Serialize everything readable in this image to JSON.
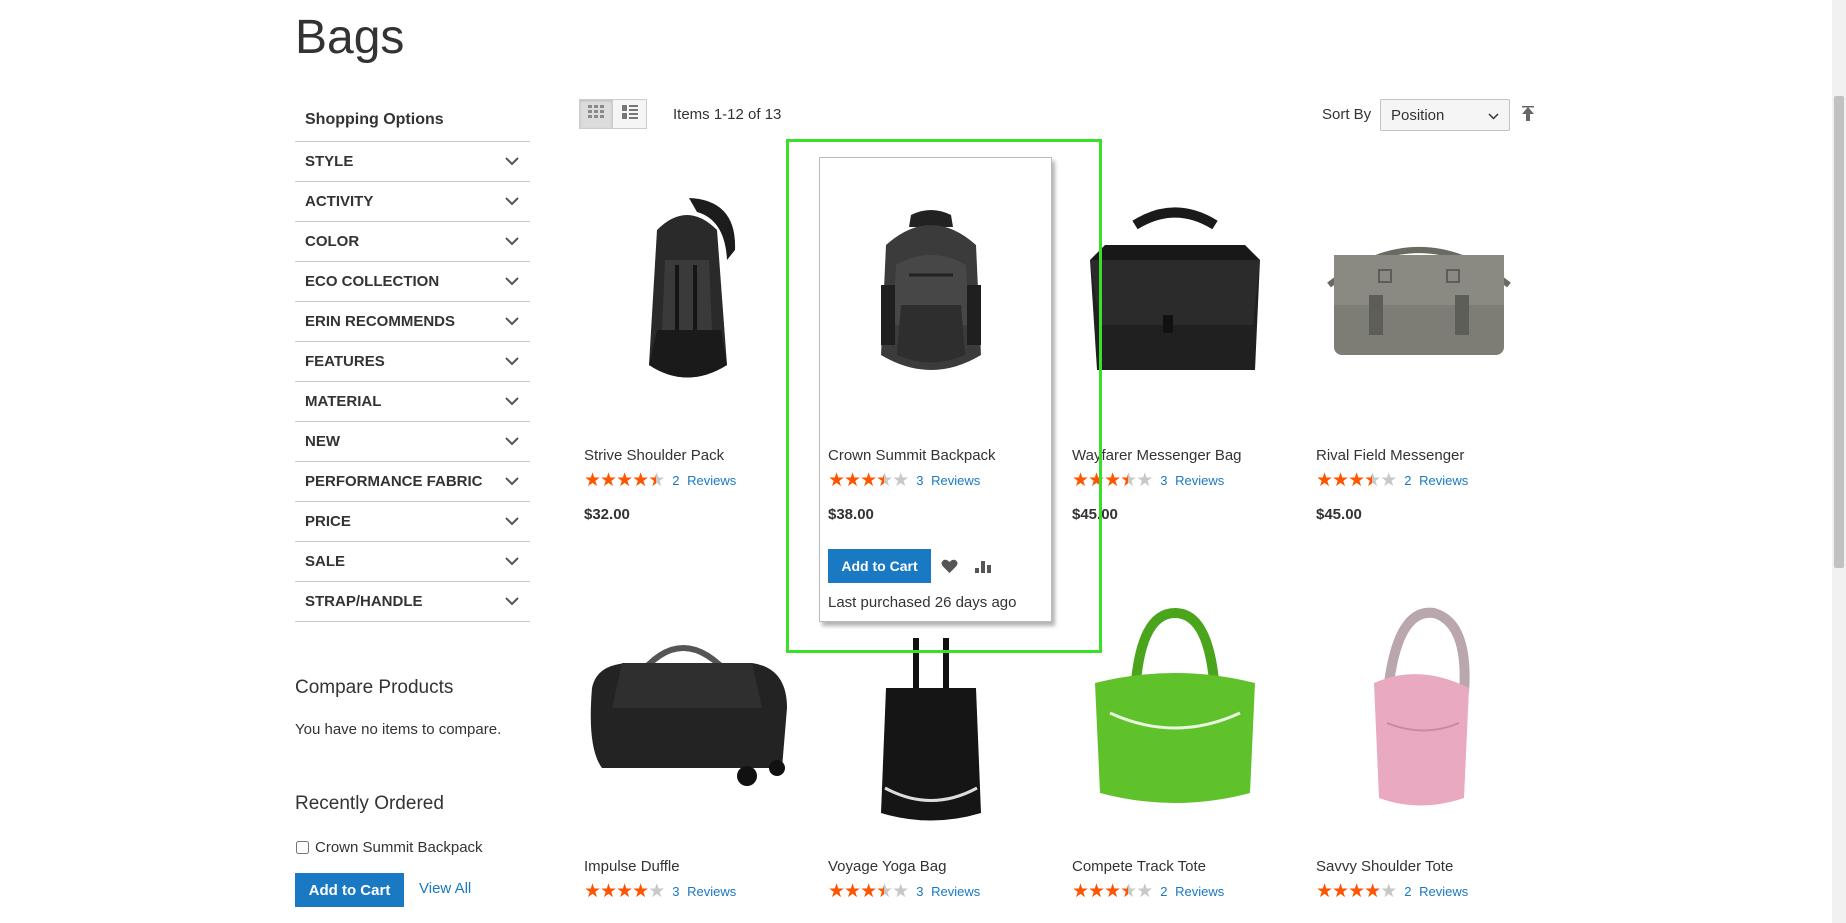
{
  "page": {
    "title": "Bags"
  },
  "sidebar": {
    "shopping_options_title": "Shopping Options",
    "filters": [
      "STYLE",
      "ACTIVITY",
      "COLOR",
      "ECO COLLECTION",
      "ERIN RECOMMENDS",
      "FEATURES",
      "MATERIAL",
      "NEW",
      "PERFORMANCE FABRIC",
      "PRICE",
      "SALE",
      "STRAP/HANDLE"
    ],
    "compare": {
      "title": "Compare Products",
      "empty_text": "You have no items to compare."
    },
    "recently_ordered": {
      "title": "Recently Ordered",
      "item": "Crown Summit Backpack",
      "add_to_cart": "Add to Cart",
      "view_all": "View All"
    }
  },
  "toolbar": {
    "items_count": "Items 1-12 of 13",
    "sort_label": "Sort By",
    "sort_value": "Position",
    "view_modes": [
      "grid",
      "list"
    ]
  },
  "products": [
    {
      "name": "Strive Shoulder Pack",
      "rating": 4.5,
      "reviews": "2  Reviews",
      "price": "$32.00",
      "color": "#2a2a2a"
    },
    {
      "name": "Crown Summit Backpack",
      "rating": 3.5,
      "reviews": "3  Reviews",
      "price": "$38.00",
      "color": "#3a3a3a"
    },
    {
      "name": "Wayfarer Messenger Bag",
      "rating": 3.5,
      "reviews": "3  Reviews",
      "price": "$45.00",
      "color": "#1e1e1e"
    },
    {
      "name": "Rival Field Messenger",
      "rating": 3.5,
      "reviews": "2  Reviews",
      "price": "$45.00",
      "color": "#7d7d76"
    },
    {
      "name": "Impulse Duffle",
      "rating": 4,
      "reviews": "3  Reviews",
      "price": "",
      "color": "#262626"
    },
    {
      "name": "Voyage Yoga Bag",
      "rating": 3.5,
      "reviews": "3  Reviews",
      "price": "",
      "color": "#151515"
    },
    {
      "name": "Compete Track Tote",
      "rating": 3.5,
      "reviews": "2  Reviews",
      "price": "",
      "color": "#5fc22a"
    },
    {
      "name": "Savvy Shoulder Tote",
      "rating": 4,
      "reviews": "2  Reviews",
      "price": "",
      "color": "#e9a9c0"
    }
  ],
  "hover_card": {
    "add_to_cart": "Add to Cart",
    "last_purchased": "Last purchased 26 days ago"
  },
  "colors": {
    "accent": "#1979c3",
    "star": "#ff5501",
    "highlight": "#3adf2a"
  }
}
